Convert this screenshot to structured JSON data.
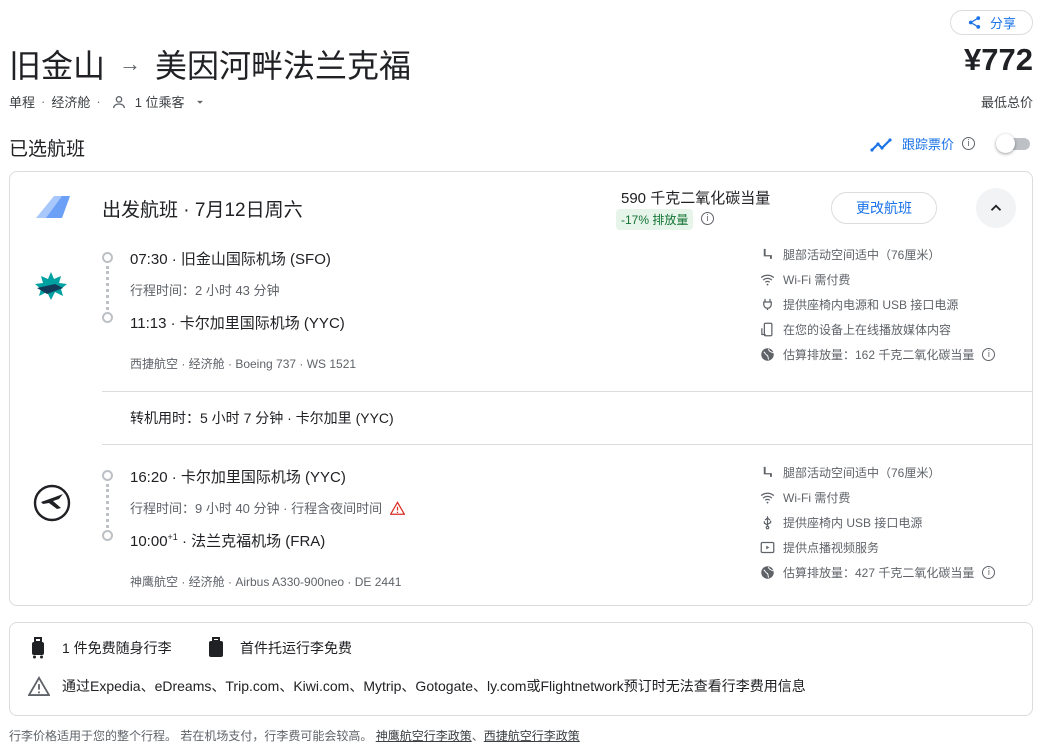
{
  "header": {
    "share_label": "分享",
    "origin": "旧金山",
    "destination": "美因河畔法兰克福",
    "arrow": "→",
    "trip_type": "单程",
    "cabin": "经济舱",
    "passengers": "1 位乘客",
    "price": "¥772",
    "price_note": "最低总价"
  },
  "selected": {
    "title": "已选航班",
    "track_label": "跟踪票价"
  },
  "departure": {
    "title": "出发航班 · 7月12日周六",
    "co2": "590 千克二氧化碳当量",
    "co2_badge": "-17% 排放量",
    "change_label": "更改航班"
  },
  "segments": [
    {
      "dep_time_line": "07:30 · 旧金山国际机场 (SFO)",
      "duration": "行程时间：2 小时 43 分钟",
      "overnight": "",
      "arr_time": "11:13",
      "arr_sup": "",
      "arr_airport": " · 卡尔加里国际机场 (YYC)",
      "details": "西捷航空 · 经济舱 · Boeing 737 · WS 1521",
      "amenities": [
        {
          "icon": "legroom-icon",
          "text": "腿部活动空间适中（76厘米）"
        },
        {
          "icon": "wifi-icon",
          "text": "Wi-Fi 需付费"
        },
        {
          "icon": "power-plug-icon",
          "text": "提供座椅内电源和 USB 接口电源"
        },
        {
          "icon": "stream-media-icon",
          "text": "在您的设备上在线播放媒体内容"
        },
        {
          "icon": "globe-icon",
          "text": "估算排放量：162 千克二氧化碳当量"
        }
      ]
    },
    {
      "dep_time_line": "16:20 · 卡尔加里国际机场 (YYC)",
      "duration": "行程时间：9 小时 40 分钟 · 行程含夜间时间",
      "overnight": "warning",
      "arr_time": "10:00",
      "arr_sup": "+1",
      "arr_airport": " · 法兰克福机场 (FRA)",
      "details": "神鹰航空 · 经济舱 · Airbus A330-900neo · DE 2441",
      "amenities": [
        {
          "icon": "legroom-icon",
          "text": "腿部活动空间适中（76厘米）"
        },
        {
          "icon": "wifi-icon",
          "text": "Wi-Fi 需付费"
        },
        {
          "icon": "usb-icon",
          "text": "提供座椅内 USB 接口电源"
        },
        {
          "icon": "video-icon",
          "text": "提供点播视频服务"
        },
        {
          "icon": "globe-icon",
          "text": "估算排放量：427 千克二氧化碳当量"
        }
      ]
    }
  ],
  "layover": "转机用时：5 小时 7 分钟 · 卡尔加里 (YYC)",
  "baggage": {
    "carry_on": "1 件免费随身行李",
    "checked": "首件托运行李免费",
    "warning": "通过Expedia、eDreams、Trip.com、Kiwi.com、Mytrip、Gotogate、ly.com或Flightnetwork预订时无法查看行李费用信息"
  },
  "footer": {
    "text": "行李价格适用于您的整个行程。 若在机场支付，行李费可能会较高。",
    "link1": "神鹰航空行李政策",
    "sep": "、",
    "link2": "西捷航空行李政策"
  },
  "colors": {
    "accent": "#1a73e8",
    "badge_bg": "#e6f4ea",
    "badge_text": "#137333",
    "warning": "#d93025"
  }
}
